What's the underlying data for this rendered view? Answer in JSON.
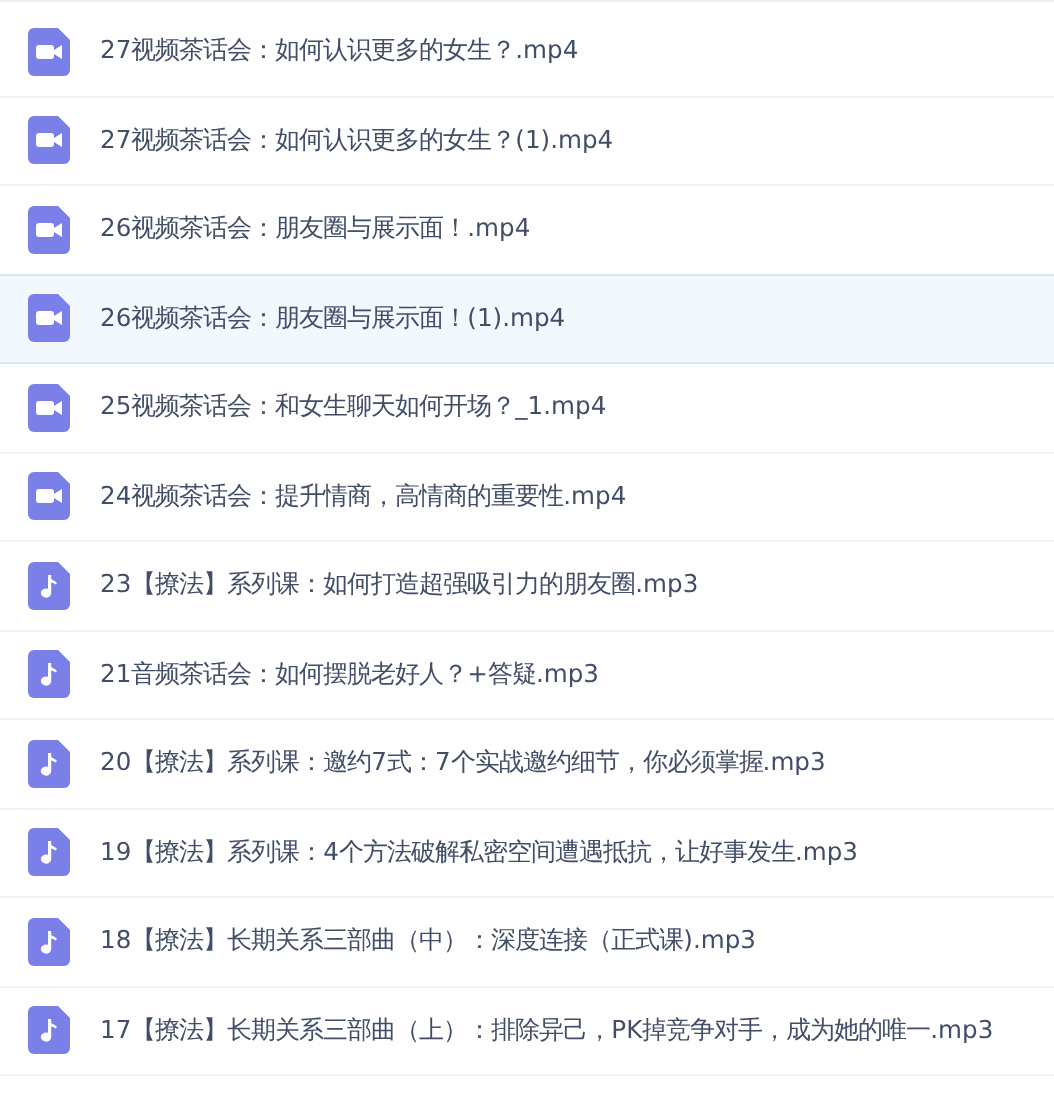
{
  "files": [
    {
      "kind": "video",
      "name": "27视频茶话会：如何认识更多的女生？.mp4",
      "selected": false
    },
    {
      "kind": "video",
      "name": "27视频茶话会：如何认识更多的女生？(1).mp4",
      "selected": false
    },
    {
      "kind": "video",
      "name": "26视频茶话会：朋友圈与展示面！.mp4",
      "selected": false
    },
    {
      "kind": "video",
      "name": "26视频茶话会：朋友圈与展示面！(1).mp4",
      "selected": true
    },
    {
      "kind": "video",
      "name": "25视频茶话会：和女生聊天如何开场？_1.mp4",
      "selected": false
    },
    {
      "kind": "video",
      "name": "24视频茶话会：提升情商，高情商的重要性.mp4",
      "selected": false
    },
    {
      "kind": "audio",
      "name": "23【撩法】系列课：如何打造超强吸引力的朋友圈.mp3",
      "selected": false
    },
    {
      "kind": "audio",
      "name": "21音频茶话会：如何摆脱老好人？+答疑.mp3",
      "selected": false
    },
    {
      "kind": "audio",
      "name": "20【撩法】系列课：邀约7式：7个实战邀约细节，你必须掌握.mp3",
      "selected": false
    },
    {
      "kind": "audio",
      "name": "19【撩法】系列课：4个方法破解私密空间遭遇抵抗，让好事发生.mp3",
      "selected": false
    },
    {
      "kind": "audio",
      "name": "18【撩法】长期关系三部曲（中）：深度连接（正式课).mp3",
      "selected": false
    },
    {
      "kind": "audio",
      "name": "17【撩法】长期关系三部曲（上）：排除异己，PK掉竞争对手，成为她的唯一.mp3",
      "selected": false
    }
  ]
}
